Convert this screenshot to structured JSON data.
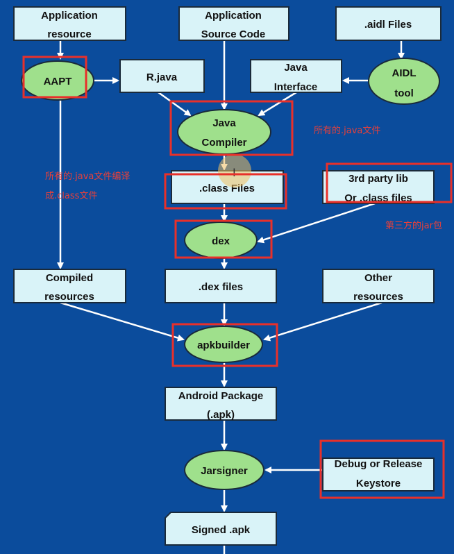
{
  "colors": {
    "background": "#0b4c9c",
    "box": "#d9f3f8",
    "process": "#9fe08c",
    "highlight": "#e8302a",
    "annotation": "#e8403a"
  },
  "nodes": {
    "app_resource": [
      "Application",
      "resource"
    ],
    "app_source": [
      "Application",
      "Source Code"
    ],
    "aidl_files": [
      ".aidl Files"
    ],
    "aapt": [
      "AAPT"
    ],
    "r_java": [
      "R.java"
    ],
    "java_interface": [
      "Java",
      "Interface"
    ],
    "aidl_tool": [
      "AIDL",
      "tool"
    ],
    "java_compiler": [
      "Java",
      "Compiler"
    ],
    "class_files": [
      ".class Files"
    ],
    "third_party": [
      "3rd party lib",
      "Or .class files"
    ],
    "dex": [
      "dex"
    ],
    "compiled_resources": [
      "Compiled",
      "resources"
    ],
    "dex_files": [
      ".dex files"
    ],
    "other_resources": [
      "Other",
      "resources"
    ],
    "apkbuilder": [
      "apkbuilder"
    ],
    "android_package": [
      "Android Package",
      "(.apk)"
    ],
    "jarsigner": [
      "Jarsigner"
    ],
    "keystore": [
      "Debug or Release",
      "Keystore"
    ],
    "signed_apk": [
      "Signed .apk"
    ]
  },
  "annotations": {
    "all_java": "所有的.java文件",
    "compile_1": "所有的.java文件编译",
    "compile_2": "成.class文件",
    "third_party_jar": "第三方的jar包"
  }
}
